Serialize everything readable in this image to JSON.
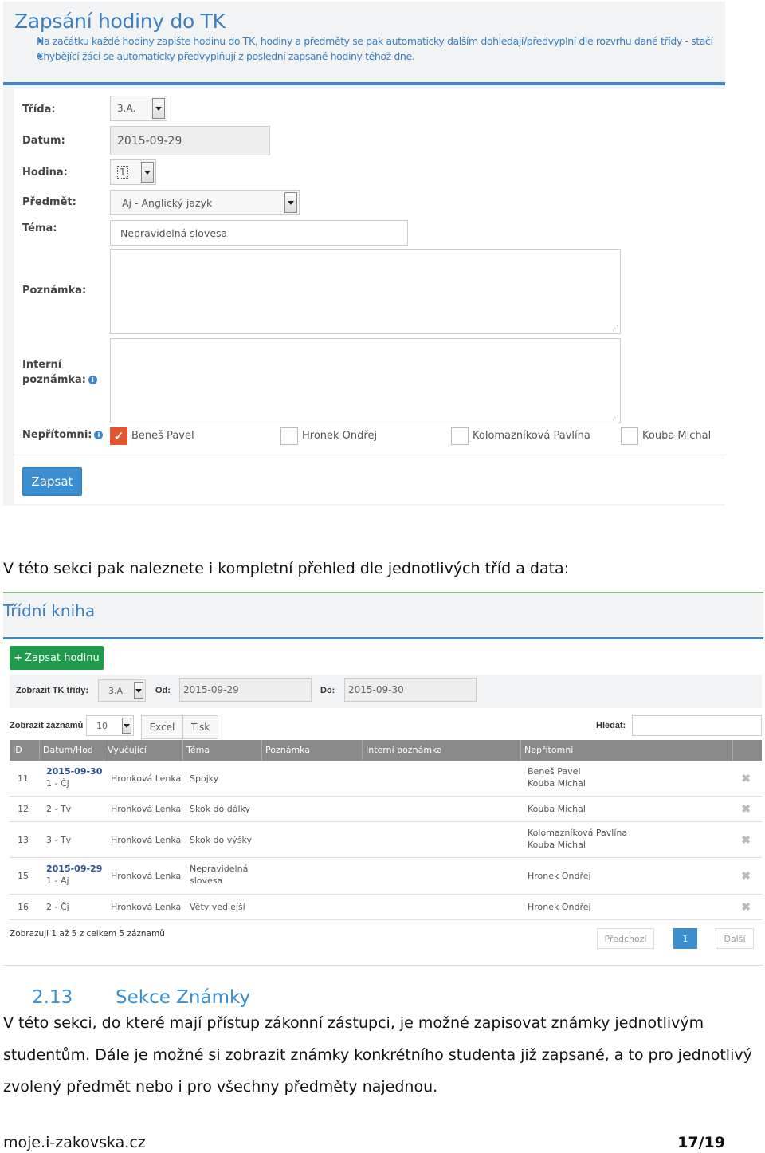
{
  "form": {
    "title": "Zapsání hodiny do TK",
    "info_lines": [
      "Na začátku každé hodiny zapište hodinu do TK, hodiny a předměty se pak automaticky dalším dohledají/předvyplní dle rozvrhu dané třídy - stačí",
      "Chybějící žáci se automaticky předvyplňují z poslední zapsané hodiny téhož dne."
    ],
    "labels": {
      "trida": "Třída:",
      "datum": "Datum:",
      "hodina": "Hodina:",
      "predmet": "Předmět:",
      "tema": "Téma:",
      "poznamka": "Poznámka:",
      "interni_1": "Interní",
      "interni_2": "poznámka:",
      "nepritomni": "Nepřítomni:"
    },
    "values": {
      "trida": "3.A.",
      "datum": "2015-09-29",
      "hodina": "1",
      "predmet": "Aj - Anglický jazyk",
      "tema": "Nepravidelná slovesa"
    },
    "students": [
      {
        "name": "Beneš Pavel",
        "checked": true
      },
      {
        "name": "Hronek Ondřej",
        "checked": false
      },
      {
        "name": "Kolomazníková Pavlína",
        "checked": false
      },
      {
        "name": "Kouba Michal",
        "checked": false
      }
    ],
    "submit_label": "Zapsat",
    "accent": "#3f87c8",
    "check_color": "#e2552d"
  },
  "text": {
    "intro": "V této sekci pak naleznete i kompletní přehled dle jednotlivých tříd a data:",
    "section_number": "2.13",
    "section_title": "Sekce Známky",
    "para_lines": [
      "V této sekci, do které mají přístup zákonní zástupci, je možné zapisovat známky jednotlivým",
      "studentům. Dále je možné si zobrazit známky konkrétního studenta již zapsané, a to pro jednotlivý",
      "zvolený předmět nebo i pro všechny předměty najednou."
    ],
    "footer_left": "moje.i-zakovska.cz",
    "footer_right": "17/19"
  },
  "book": {
    "title": "Třídní kniha",
    "add_button": "Zapsat hodinu",
    "filter": {
      "class_label": "Zobrazit TK třídy:",
      "class_value": "3.A.",
      "from_label": "Od:",
      "from_value": "2015-09-29",
      "to_label": "Do:",
      "to_value": "2015-09-30"
    },
    "records_label": "Zobrazit záznamů",
    "records_value": "10",
    "excel": "Excel",
    "print": "Tisk",
    "search_label": "Hledat:",
    "columns": [
      "ID",
      "Datum/Hod",
      "Vyučující",
      "Téma",
      "Poznámka",
      "Interní poznámka",
      "Nepřítomni"
    ],
    "rows": [
      {
        "id": "11",
        "date": "2015-09-30",
        "hour": "1 - Čj",
        "teacher": "Hronková Lenka",
        "topic_1": "Spojky",
        "topic_2": "",
        "absent_1": "Beneš Pavel",
        "absent_2": "Kouba Michal"
      },
      {
        "id": "12",
        "date": "",
        "hour": "2 - Tv",
        "teacher": "Hronková Lenka",
        "topic_1": "Skok do dálky",
        "topic_2": "",
        "absent_1": "Kouba Michal",
        "absent_2": ""
      },
      {
        "id": "13",
        "date": "",
        "hour": "3 - Tv",
        "teacher": "Hronková Lenka",
        "topic_1": "Skok do výšky",
        "topic_2": "",
        "absent_1": "Kolomazníková Pavlína",
        "absent_2": "Kouba Michal"
      },
      {
        "id": "15",
        "date": "2015-09-29",
        "hour": "1 - Aj",
        "teacher": "Hronková Lenka",
        "topic_1": "Nepravidelná",
        "topic_2": "slovesa",
        "absent_1": "Hronek Ondřej",
        "absent_2": ""
      },
      {
        "id": "16",
        "date": "",
        "hour": "2 - Čj",
        "teacher": "Hronková Lenka",
        "topic_1": "Věty vedlejší",
        "topic_2": "",
        "absent_1": "Hronek Ondřej",
        "absent_2": ""
      }
    ],
    "summary": "Zobrazuji 1 až 5 z celkem 5 záznamů",
    "prev": "Předchozí",
    "page": "1",
    "next": "Další",
    "green": "#1e9a4a"
  }
}
